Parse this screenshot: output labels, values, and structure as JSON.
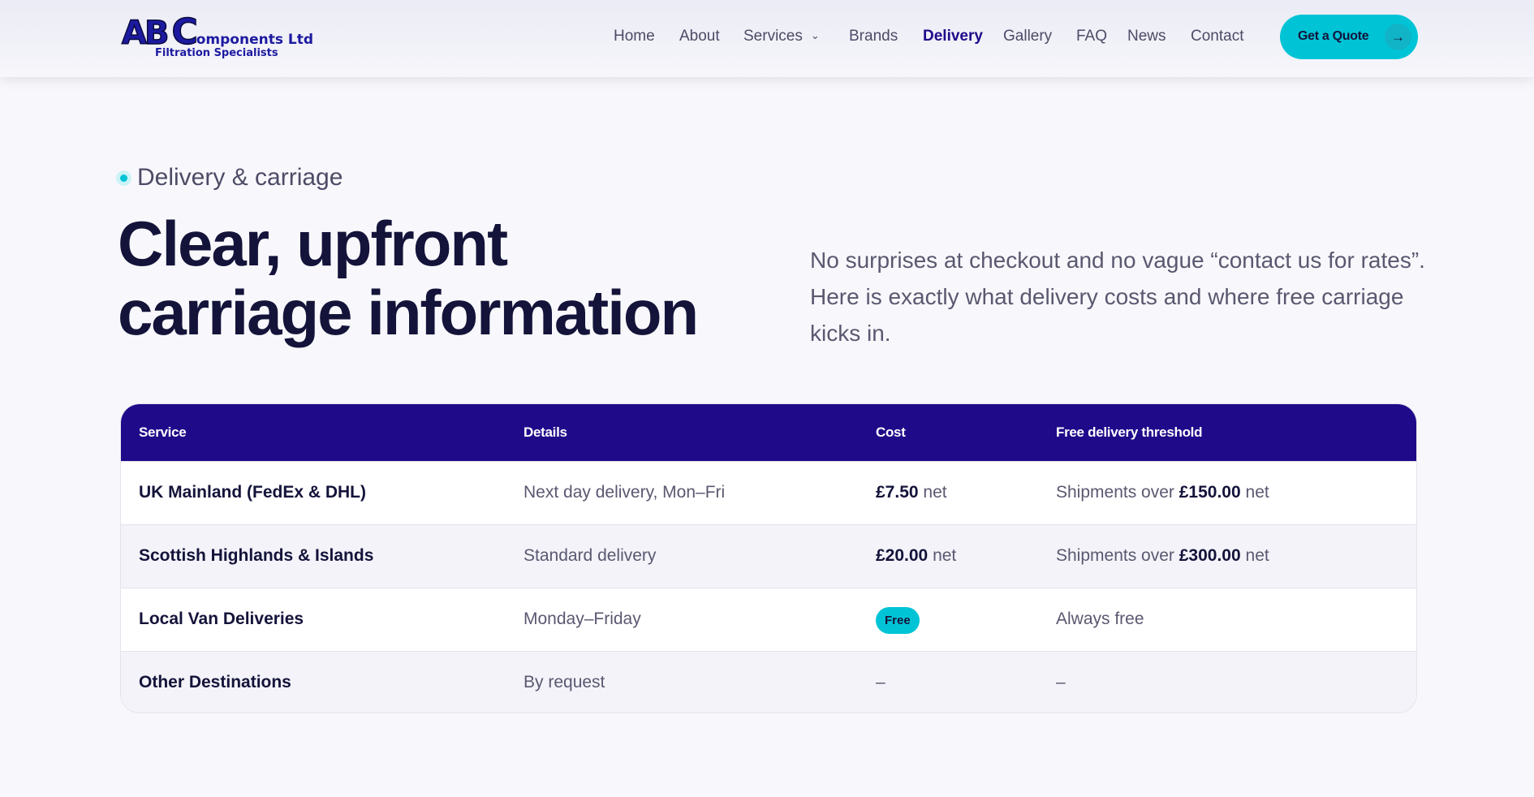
{
  "logo": {
    "brand_ab": "AB",
    "brand_c": "C",
    "brand_rest": "omponents Ltd",
    "tagline": "Filtration Specialists"
  },
  "nav": {
    "items": [
      {
        "label": "Home"
      },
      {
        "label": "About"
      },
      {
        "label": "Services",
        "dropdown_icon": "chevron-down-icon"
      },
      {
        "label": "Brands"
      },
      {
        "label": "Delivery",
        "active": true
      },
      {
        "label": "Gallery"
      },
      {
        "label": "FAQ"
      },
      {
        "label": "News"
      },
      {
        "label": "Contact"
      }
    ],
    "cta": {
      "label": "Get a Quote",
      "icon": "arrow-right-icon"
    }
  },
  "hero": {
    "eyebrow": "Delivery & carriage",
    "title_line1": "Clear, upfront",
    "title_line2": "carriage information",
    "description": "No surprises at checkout and no vague “contact us for rates”. Here is exactly what delivery costs and where free carriage kicks in."
  },
  "table": {
    "headers": [
      "Service",
      "Details",
      "Cost",
      "Free delivery threshold"
    ],
    "rows": [
      {
        "service": "UK Mainland (FedEx & DHL)",
        "details": "Next day delivery, Mon–Fri",
        "cost_value": "£7.50",
        "cost_suffix": "net",
        "threshold_prefix": "Shipments over",
        "threshold_value": "£150.00",
        "threshold_suffix": "net"
      },
      {
        "service": "Scottish Highlands & Islands",
        "details": "Standard delivery",
        "cost_value": "£20.00",
        "cost_suffix": "net",
        "threshold_prefix": "Shipments over",
        "threshold_value": "£300.00",
        "threshold_suffix": "net"
      },
      {
        "service": "Local Van Deliveries",
        "details": "Monday–Friday",
        "cost_badge": "Free",
        "threshold": "Always free"
      },
      {
        "service": "Other Destinations",
        "details": "By request",
        "cost": "–",
        "threshold": "–"
      }
    ]
  },
  "colors": {
    "primary": "#1f0a8a",
    "accent": "#00c4d6",
    "text_dark": "#14133a",
    "text_muted": "#5a5870",
    "background": "#f8f8fc"
  }
}
